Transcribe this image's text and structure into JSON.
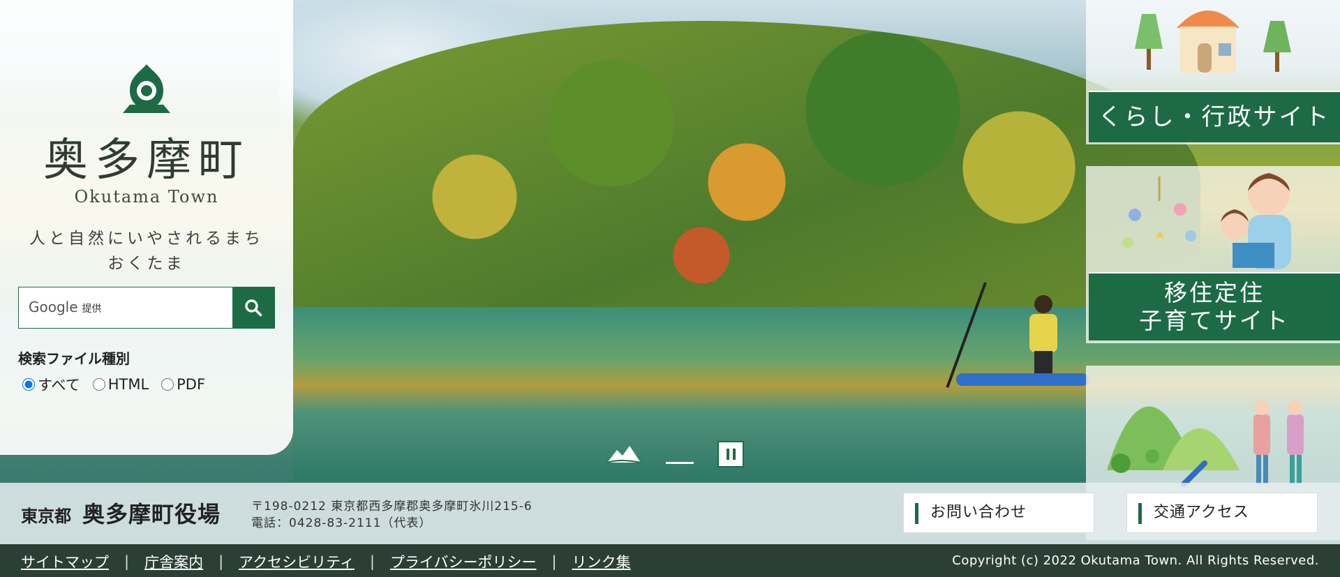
{
  "site": {
    "town_name_jp": "奥多摩町",
    "town_name_en": "Okutama Town",
    "tagline": "人と自然にいやされるまち\nおくたま"
  },
  "search": {
    "provider_label": "Google",
    "provider_suffix": "提供",
    "button_icon": "search-icon",
    "file_type_label": "検索ファイル種別",
    "file_types": [
      "すべて",
      "HTML",
      "PDF"
    ],
    "selected": "すべて"
  },
  "banners": {
    "living": "くらし・行政サイト",
    "migration": "移住定住\n子育てサイト"
  },
  "slider": {
    "state": "playing"
  },
  "office": {
    "prefecture": "東京都",
    "name": "奥多摩町役場",
    "address": "〒198-0212 東京都西多摩郡奥多摩町氷川215-6",
    "phone": "電話：0428-83-2111（代表）",
    "contact_button": "お問い合わせ",
    "access_button": "交通アクセス"
  },
  "footer": {
    "links": [
      "サイトマップ",
      "庁舎案内",
      "アクセシビリティ",
      "プライバシーポリシー",
      "リンク集"
    ],
    "copyright": "Copyright (c) 2022 Okutama Town. All Rights Reserved."
  },
  "colors": {
    "brand_green": "#1c6b45",
    "footer_bg": "#2c3f36"
  }
}
